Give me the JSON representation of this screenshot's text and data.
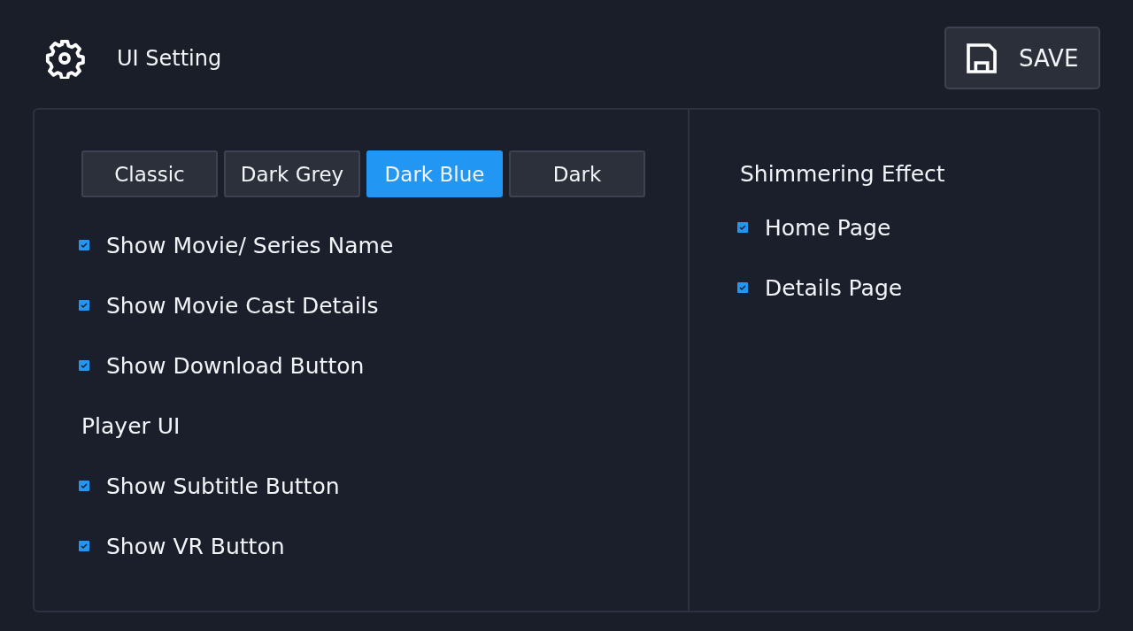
{
  "header": {
    "title": "UI Setting",
    "save_button": "SAVE"
  },
  "themes": [
    {
      "label": "Classic",
      "selected": false
    },
    {
      "label": "Dark Grey",
      "selected": false
    },
    {
      "label": "Dark Blue",
      "selected": true
    },
    {
      "label": "Dark",
      "selected": false
    }
  ],
  "left_items": [
    {
      "kind": "checkbox",
      "label": "Show Movie/ Series Name",
      "checked": true
    },
    {
      "kind": "checkbox",
      "label": "Show Movie Cast Details",
      "checked": true
    },
    {
      "kind": "checkbox",
      "label": "Show Download Button",
      "checked": true
    },
    {
      "kind": "heading",
      "label": "Player UI"
    },
    {
      "kind": "checkbox",
      "label": "Show Subtitle Button",
      "checked": true
    },
    {
      "kind": "checkbox",
      "label": "Show VR Button",
      "checked": true
    }
  ],
  "right": {
    "heading": "Shimmering Effect",
    "items": [
      {
        "label": "Home Page",
        "checked": true
      },
      {
        "label": "Details Page",
        "checked": true
      }
    ]
  }
}
